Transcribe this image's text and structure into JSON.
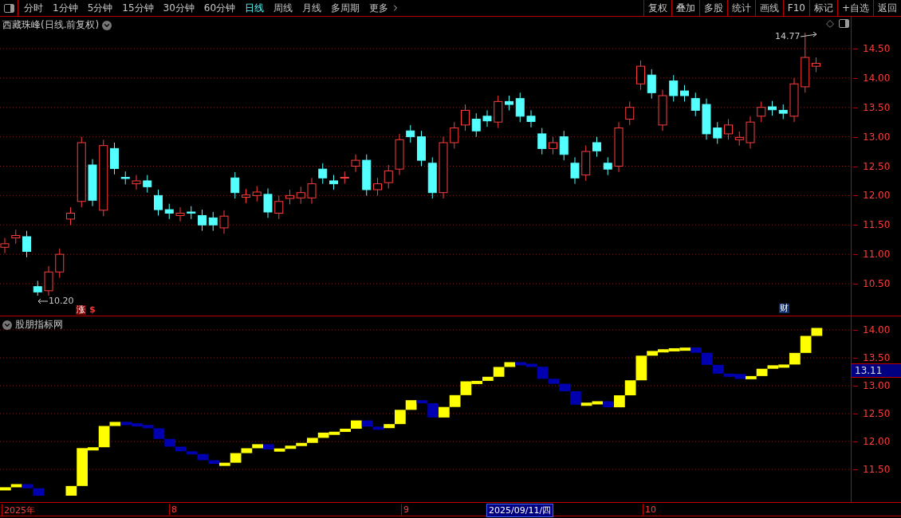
{
  "toolbar": {
    "periods": [
      {
        "label": "分时",
        "selected": false
      },
      {
        "label": "1分钟",
        "selected": false
      },
      {
        "label": "5分钟",
        "selected": false
      },
      {
        "label": "15分钟",
        "selected": false
      },
      {
        "label": "30分钟",
        "selected": false
      },
      {
        "label": "60分钟",
        "selected": false
      },
      {
        "label": "日线",
        "selected": true
      },
      {
        "label": "周线",
        "selected": false
      },
      {
        "label": "月线",
        "selected": false
      },
      {
        "label": "多周期",
        "selected": false
      }
    ],
    "more": "更多",
    "actions": [
      "复权",
      "叠加",
      "多股",
      "统计",
      "画线",
      "F10",
      "标记",
      "+自选",
      "返回"
    ]
  },
  "main_chart": {
    "title": "西藏珠峰(日线.前复权)",
    "y_labels": [
      "14.50",
      "14.00",
      "13.50",
      "13.00",
      "12.50",
      "12.00",
      "11.50",
      "11.00",
      "10.50"
    ],
    "high_label": "14.77",
    "low_label": "10.20",
    "markers": [
      {
        "label": "涨",
        "kind": "badge"
      },
      {
        "label": "$",
        "kind": "symbol"
      },
      {
        "label": "财",
        "kind": "finance"
      }
    ]
  },
  "indicator": {
    "title": "股朋指标网",
    "y_labels": [
      "14.00",
      "13.50",
      "13.00",
      "12.50",
      "12.00",
      "11.50"
    ],
    "current_value": "13.11"
  },
  "x_axis": {
    "labels": [
      {
        "label": "2025年",
        "selected": false
      },
      {
        "label": "8",
        "selected": false
      },
      {
        "label": "9",
        "selected": false
      },
      {
        "label": "2025/09/11/四",
        "selected": true
      },
      {
        "label": "10",
        "selected": false
      }
    ]
  }
}
